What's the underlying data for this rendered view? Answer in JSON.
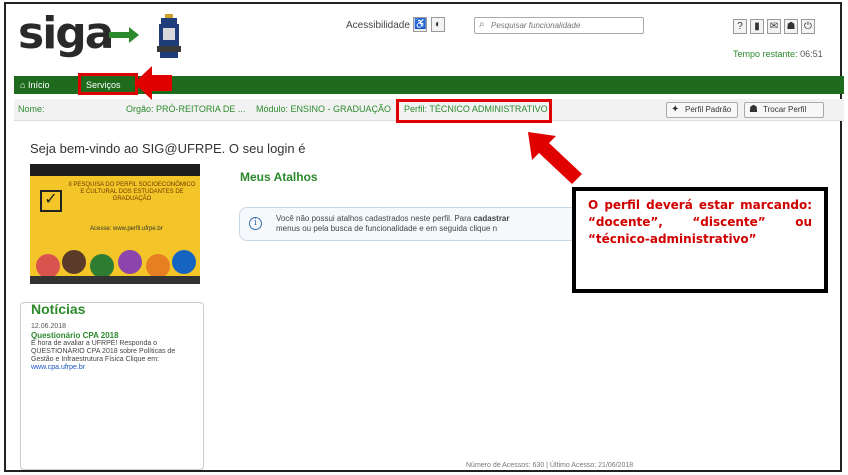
{
  "app": {
    "logo": "siga"
  },
  "header": {
    "accessibility_label": "Acessibilidade",
    "search_placeholder": "Pesquisar funcionalidade",
    "time_label": "Tempo restante:",
    "time_value": "06:51"
  },
  "menu": {
    "inicio": "Início",
    "servicos": "Serviços"
  },
  "infobar": {
    "nome": "Nome:",
    "orgao": "Orgão: PRÓ-REITORIA DE ...",
    "modulo": "Módulo: ENSINO - GRADUAÇÃO",
    "perfil": "Perfil: TÉCNICO ADMINISTRATIVO",
    "perfil_padrao": "Perfil Padrão",
    "trocar_perfil": "Trocar Perfil"
  },
  "welcome": "Seja bem-vindo ao SIG@UFRPE. O seu login é",
  "banner": {
    "tagline": "II PESQUISA DO PERFIL SOCIOECONÔMICO E CULTURAL DOS ESTUDANTES DE GRADUAÇÃO",
    "site": "Acesse: www.perfil.ufrpe.br"
  },
  "news": {
    "heading": "Notícias",
    "date": "12.06.2018",
    "title": "Questionário CPA 2018",
    "body": "É hora de avaliar a UFRPE! Responda o QUESTIONÁRIO CPA 2018 sobre Políticas de Gestão e Infraestrutura Física Clique em:",
    "link": "www.cpa.ufrpe.br"
  },
  "shortcuts": {
    "heading": "Meus Atalhos",
    "line1_pre": "Você não possui atalhos cadastrados neste perfil. Para",
    "line1_bold": "cadastrar",
    "line2": "menus ou pela busca de funcionalidade e em seguida clique n"
  },
  "callout": "O perfil deverá estar marcando: “docente”, “discente” ou “técnico-administrativo”",
  "footer": "Número de Acessos: 630 | Último Acesso: 21/06/2018",
  "colors": {
    "brand_green": "#1e6b1e",
    "accent_red": "#e00000"
  }
}
